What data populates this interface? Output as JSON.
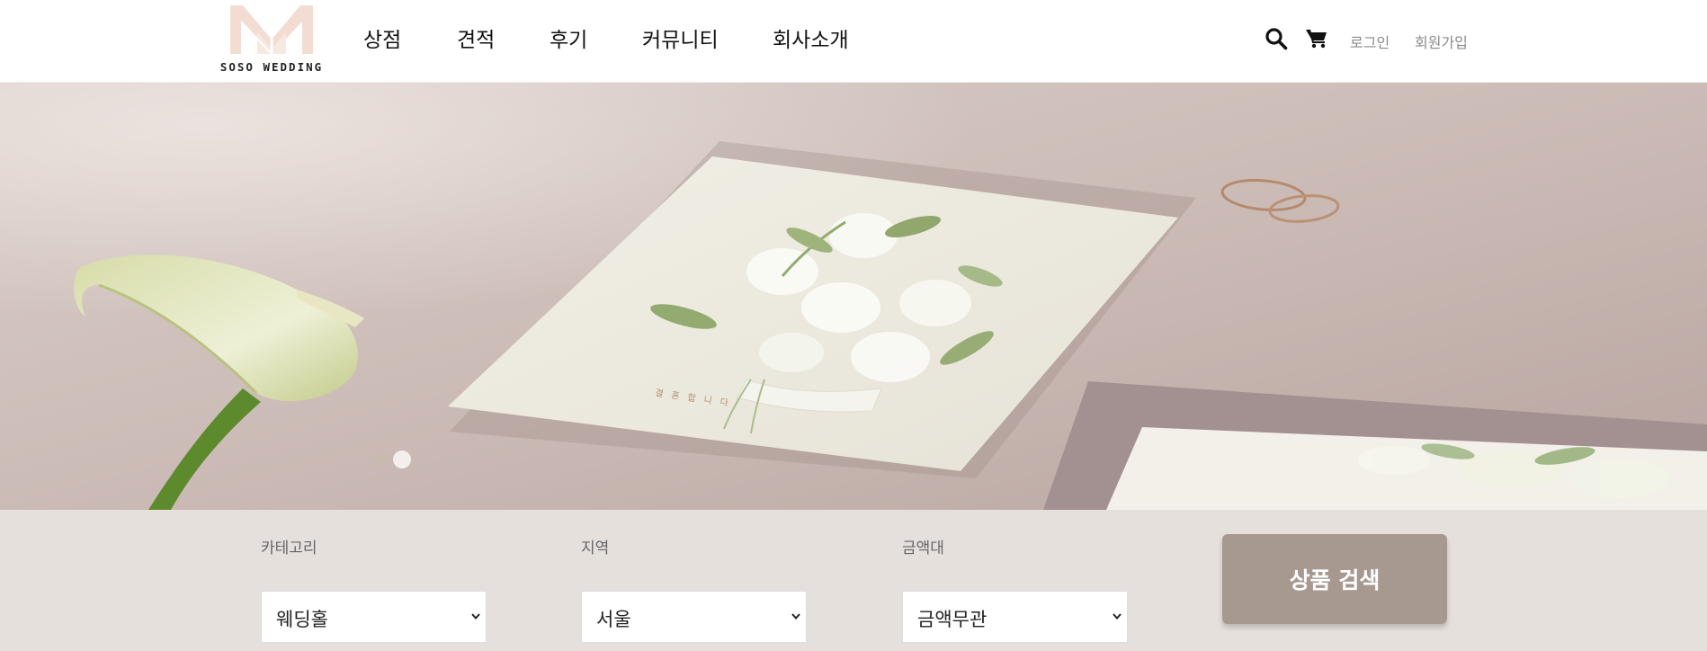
{
  "brand": {
    "name": "SOSO WEDDING",
    "logo_color": "#f3ddd3"
  },
  "nav": {
    "items": [
      {
        "label": "상점"
      },
      {
        "label": "견적"
      },
      {
        "label": "후기"
      },
      {
        "label": "커뮤니티"
      },
      {
        "label": "회사소개"
      }
    ]
  },
  "utility": {
    "search_icon": "search-icon",
    "cart_icon": "cart-icon",
    "login_label": "로그인",
    "signup_label": "회원가입"
  },
  "hero": {
    "invitation_text": "결혼합니다",
    "slide_count": 2,
    "active_slide": 2
  },
  "search_form": {
    "category": {
      "label": "카테고리",
      "selected": "웨딩홀"
    },
    "region": {
      "label": "지역",
      "selected": "서울"
    },
    "price": {
      "label": "금액대",
      "selected": "금액무관"
    },
    "submit_label": "상품 검색"
  },
  "colors": {
    "accent": "#a89990",
    "search_bar_bg": "#e6e0dc",
    "hero_bg": "#c9b8b3"
  }
}
